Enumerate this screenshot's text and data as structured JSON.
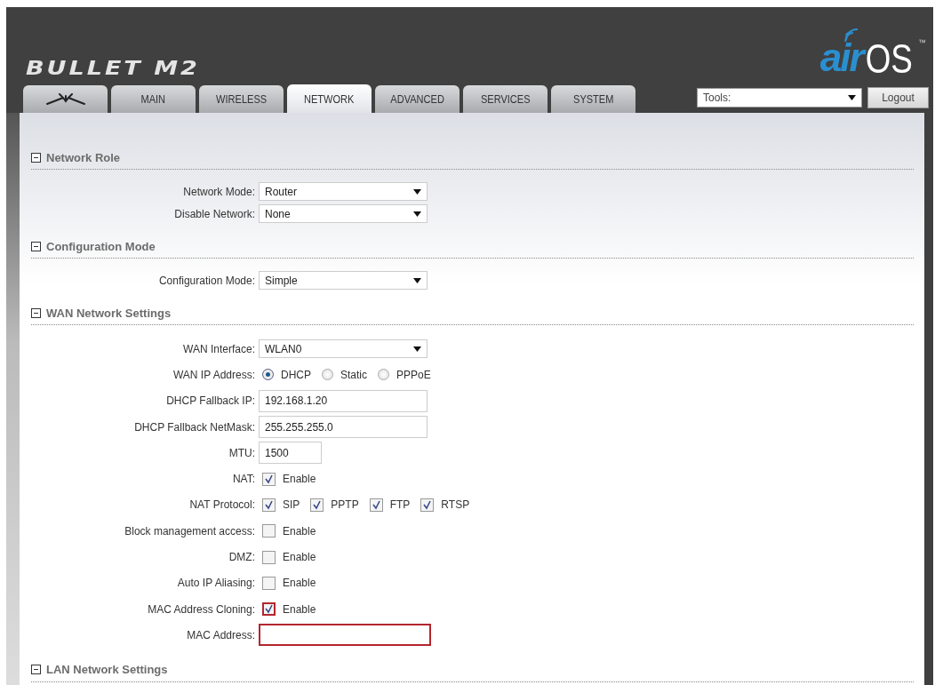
{
  "header": {
    "product_logo": "BULLET M2",
    "os_logo": {
      "prefix": "air",
      "name": "OS",
      "mark": "™"
    }
  },
  "tabs": [
    {
      "kind": "icon",
      "selected": false
    },
    {
      "kind": "text",
      "label": "MAIN",
      "selected": false
    },
    {
      "kind": "text",
      "label": "WIRELESS",
      "selected": false
    },
    {
      "kind": "text",
      "label": "NETWORK",
      "selected": true
    },
    {
      "kind": "text",
      "label": "ADVANCED",
      "selected": false
    },
    {
      "kind": "text",
      "label": "SERVICES",
      "selected": false
    },
    {
      "kind": "text",
      "label": "SYSTEM",
      "selected": false
    }
  ],
  "tools": {
    "value": "Tools:"
  },
  "logout_button": "Logout",
  "sections": [
    {
      "title": "Network Role",
      "expanded": true,
      "rows": [
        {
          "kind": "select",
          "label": "Network Mode:",
          "value": "Router"
        },
        {
          "kind": "select",
          "label": "Disable Network:",
          "value": "None"
        }
      ]
    },
    {
      "title": "Configuration Mode",
      "expanded": true,
      "rows": [
        {
          "kind": "select",
          "label": "Configuration Mode:",
          "value": "Simple"
        }
      ]
    },
    {
      "title": "WAN Network Settings",
      "expanded": true,
      "rows": [
        {
          "kind": "select",
          "label": "WAN Interface:",
          "value": "WLAN0"
        },
        {
          "kind": "radio",
          "label": "WAN IP Address:",
          "options": [
            {
              "label": "DHCP",
              "selected": true
            },
            {
              "label": "Static",
              "selected": false
            },
            {
              "label": "PPPoE",
              "selected": false
            }
          ]
        },
        {
          "kind": "text",
          "label": "DHCP Fallback IP:",
          "value": "192.168.1.20"
        },
        {
          "kind": "text",
          "label": "DHCP Fallback NetMask:",
          "value": "255.255.255.0"
        },
        {
          "kind": "short-text",
          "label": "MTU:",
          "value": "1500"
        },
        {
          "kind": "checks",
          "label": "NAT:",
          "options": [
            {
              "label": "Enable",
              "checked": true
            }
          ]
        },
        {
          "kind": "checks",
          "label": "NAT Protocol:",
          "options": [
            {
              "label": "SIP",
              "checked": true
            },
            {
              "label": "PPTP",
              "checked": true
            },
            {
              "label": "FTP",
              "checked": true
            },
            {
              "label": "RTSP",
              "checked": true
            }
          ]
        },
        {
          "kind": "checks",
          "label": "Block management access:",
          "options": [
            {
              "label": "Enable",
              "checked": false
            }
          ]
        },
        {
          "kind": "checks",
          "label": "DMZ:",
          "options": [
            {
              "label": "Enable",
              "checked": false
            }
          ]
        },
        {
          "kind": "checks",
          "label": "Auto IP Aliasing:",
          "options": [
            {
              "label": "Enable",
              "checked": false
            }
          ]
        },
        {
          "kind": "checks",
          "label": "MAC Address Cloning:",
          "options": [
            {
              "label": "Enable",
              "checked": true,
              "highlighted": true
            }
          ]
        },
        {
          "kind": "text",
          "label": "MAC Address:",
          "highlighted": true
        }
      ]
    },
    {
      "title": "LAN Network Settings",
      "expanded": true
    }
  ]
}
